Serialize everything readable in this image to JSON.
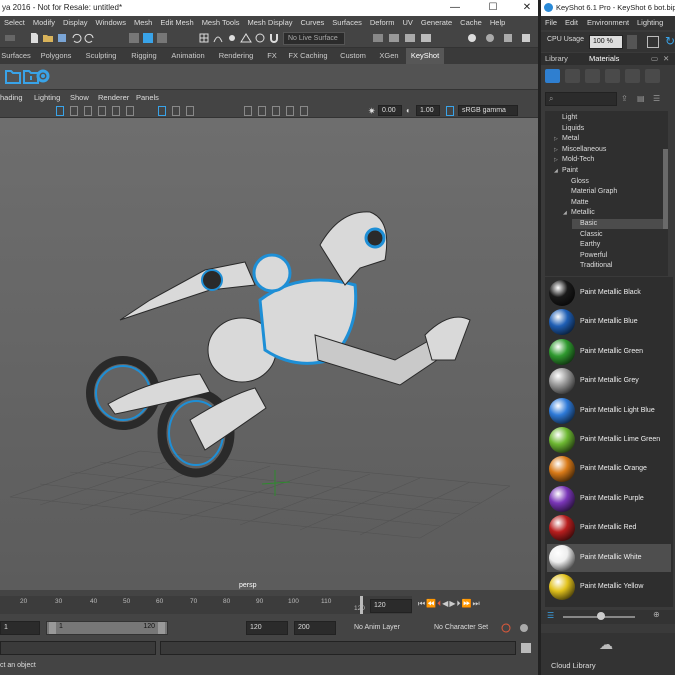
{
  "maya": {
    "title": "ya 2016 - Not for Resale: untitled*",
    "menu": [
      "Select",
      "Modify",
      "Display",
      "Windows",
      "Mesh",
      "Edit Mesh",
      "Mesh Tools",
      "Mesh Display",
      "Curves",
      "Surfaces",
      "Deform",
      "UV",
      "Generate",
      "Cache",
      "Help"
    ],
    "live_surface": "No Live Surface",
    "shelf_tabs": [
      "Surfaces",
      "Polygons",
      "Sculpting",
      "Rigging",
      "Animation",
      "Rendering",
      "FX",
      "FX Caching",
      "Custom",
      "XGen",
      "KeyShot"
    ],
    "active_shelf_tab": "KeyShot",
    "viewport_menu": [
      "hading",
      "Lighting",
      "Show",
      "Renderer",
      "Panels"
    ],
    "exposure": "0.00",
    "gamma": "1.00",
    "color_space": "sRGB gamma",
    "camera_label": "persp",
    "timeline_ticks": [
      "20",
      "30",
      "40",
      "50",
      "60",
      "70",
      "80",
      "90",
      "100",
      "110",
      "120"
    ],
    "current_frame": "120",
    "range_start": "1",
    "range_start_inner": "1",
    "range_end_inner": "120",
    "range_end": "120",
    "anim_end": "200",
    "anim_layer": "No Anim Layer",
    "character_set": "No Character Set",
    "help_text": "ct an object",
    "accent": "#39a3e8",
    "robot_body": "#d9d9d9",
    "robot_dark": "#2a2a2a",
    "robot_accent": "#1e8fd6"
  },
  "keyshot": {
    "title": "KeyShot 6.1 Pro  -  KeyShot 6 bot.bip",
    "menu": [
      "File",
      "Edit",
      "Environment",
      "Lighting"
    ],
    "cpu_label": "CPU Usage",
    "cpu_value": "100 %",
    "tabs": [
      "Library",
      "Materials"
    ],
    "active_tab": "Materials",
    "tree": [
      {
        "label": "Light",
        "indent": 1
      },
      {
        "label": "Liquids",
        "indent": 1
      },
      {
        "label": "Metal",
        "indent": 1,
        "arrow": "▷"
      },
      {
        "label": "Miscellaneous",
        "indent": 1,
        "arrow": "▷"
      },
      {
        "label": "Mold-Tech",
        "indent": 1,
        "arrow": "▷"
      },
      {
        "label": "Paint",
        "indent": 1,
        "arrow": "◢"
      },
      {
        "label": "Gloss",
        "indent": 2
      },
      {
        "label": "Material Graph",
        "indent": 2
      },
      {
        "label": "Matte",
        "indent": 2
      },
      {
        "label": "Metallic",
        "indent": 2,
        "arrow": "◢"
      },
      {
        "label": "Basic",
        "indent": 3,
        "selected": true
      },
      {
        "label": "Classic",
        "indent": 3
      },
      {
        "label": "Earthy",
        "indent": 3
      },
      {
        "label": "Powerful",
        "indent": 3
      },
      {
        "label": "Traditional",
        "indent": 3
      }
    ],
    "materials": [
      {
        "label": "Paint Metallic Black",
        "color": "#1a1a1a"
      },
      {
        "label": "Paint Metallic Blue",
        "color": "#1f5fb5"
      },
      {
        "label": "Paint Metallic Green",
        "color": "#2f9a2f"
      },
      {
        "label": "Paint Metallic Grey",
        "color": "#9a9a9a"
      },
      {
        "label": "Paint Metallic Light Blue",
        "color": "#2e7ad8"
      },
      {
        "label": "Paint Metallic Lime Green",
        "color": "#6db832"
      },
      {
        "label": "Paint Metallic Orange",
        "color": "#d97a18"
      },
      {
        "label": "Paint Metallic Purple",
        "color": "#7a36b8"
      },
      {
        "label": "Paint Metallic Red",
        "color": "#b81e1e"
      },
      {
        "label": "Paint Metallic White",
        "color": "#eeeeee",
        "selected": true
      },
      {
        "label": "Paint Metallic Yellow",
        "color": "#e2c21c"
      }
    ],
    "cloud_label": "Cloud Library"
  }
}
